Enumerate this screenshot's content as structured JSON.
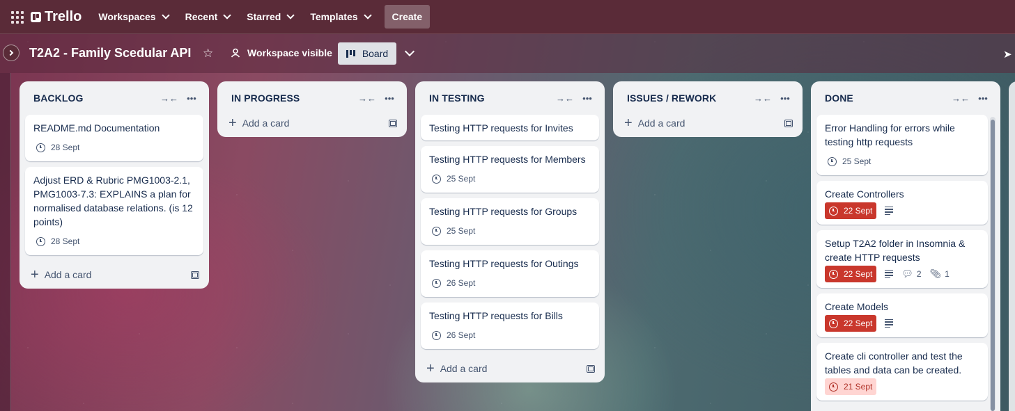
{
  "topbar": {
    "brand": "Trello",
    "nav": [
      "Workspaces",
      "Recent",
      "Starred",
      "Templates"
    ],
    "create_label": "Create"
  },
  "board": {
    "title": "T2A2 - Family Scedular API",
    "visibility": "Workspace visible",
    "view": "Board"
  },
  "lists": [
    {
      "title": "BACKLOG",
      "cards": [
        {
          "title": "README.md Documentation",
          "date": "28 Sept"
        },
        {
          "title": "Adjust ERD & Rubric PMG1003-2.1, PMG1003-7.3: EXPLAINS a plan for normalised database relations. (is 12 points)",
          "date": "28 Sept"
        }
      ],
      "add_label": "Add a card"
    },
    {
      "title": "IN PROGRESS",
      "cards": [],
      "add_label": "Add a card"
    },
    {
      "title": "IN TESTING",
      "cards": [
        {
          "title": "Testing HTTP requests for Invites"
        },
        {
          "title": "Testing HTTP requests for Members",
          "date": "25 Sept"
        },
        {
          "title": "Testing HTTP requests for Groups",
          "date": "25 Sept"
        },
        {
          "title": "Testing HTTP requests for Outings",
          "date": "26 Sept"
        },
        {
          "title": "Testing HTTP requests for Bills",
          "date": "26 Sept"
        }
      ],
      "add_label": "Add a card"
    },
    {
      "title": "ISSUES / REWORK",
      "cards": [],
      "add_label": "Add a card"
    },
    {
      "title": "DONE",
      "cards": [
        {
          "title": "Error Handling for errors while testing http requests",
          "date": "25 Sept"
        },
        {
          "title": "Create Controllers",
          "date": "22 Sept",
          "status": "overdue",
          "description": true
        },
        {
          "title": "Setup T2A2 folder in Insomnia & create HTTP requests",
          "date": "22 Sept",
          "status": "overdue",
          "description": true,
          "comments": "2",
          "attachments": "1"
        },
        {
          "title": "Create Models",
          "date": "22 Sept",
          "status": "overdue",
          "description": true
        },
        {
          "title": "Create cli controller and test the tables and data can be created.",
          "date": "21 Sept",
          "status": "due-soon"
        }
      ]
    }
  ],
  "colors": {
    "topbar": "#5a2b38",
    "list_bg": "#f1f2f4",
    "overdue": "#c9372c",
    "due_soon": "#ffd5d2"
  }
}
